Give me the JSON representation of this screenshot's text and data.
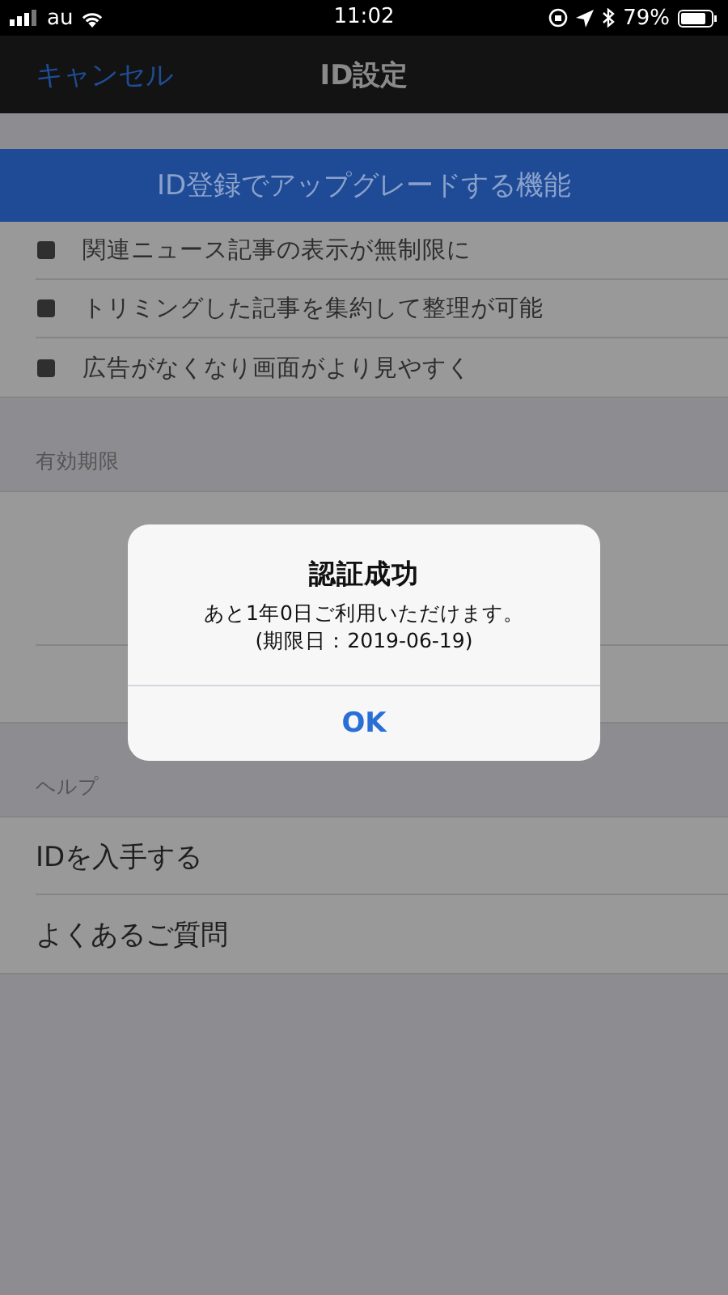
{
  "status_bar": {
    "carrier": "au",
    "time": "11:02",
    "battery": "79%"
  },
  "nav_bar": {
    "cancel": "キャンセル",
    "title": "ID設定"
  },
  "banner": "ID登録でアップグレードする機能",
  "features": [
    "関連ニュース記事の表示が無制限に",
    "トリミングした記事を集約して整理が可能",
    "広告がなくなり画面がより見やすく"
  ],
  "expiry_section": {
    "header": "有効期限"
  },
  "help_section": {
    "header": "ヘルプ",
    "rows": [
      "IDを入手する",
      "よくあるご質問"
    ]
  },
  "alert": {
    "title": "認証成功",
    "message_lines": [
      "あと1年0日ご利用いただけます。",
      "(期限日：2019-06-19)"
    ],
    "button": "OK"
  }
}
